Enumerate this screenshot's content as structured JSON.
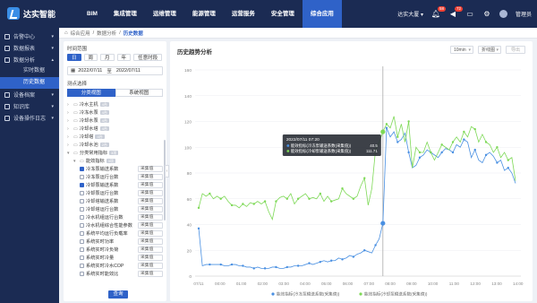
{
  "app": {
    "name": "达实智能"
  },
  "nav": [
    "BIM",
    "集成管理",
    "运维管理",
    "能源管理",
    "运营服务",
    "安全管理",
    "综合应用"
  ],
  "nav_active_index": 6,
  "top_right": {
    "building": "达实大厦",
    "bell_badge": "58",
    "alert_badge": "72",
    "user": "管理员"
  },
  "sidebar": {
    "items": [
      {
        "label": "告警中心",
        "expanded": false
      },
      {
        "label": "数据报表",
        "expanded": false
      },
      {
        "label": "数据分析",
        "expanded": true,
        "children": [
          {
            "label": "实时数据",
            "active": false
          },
          {
            "label": "历史数据",
            "active": true
          }
        ]
      },
      {
        "label": "设备档案",
        "expanded": false
      },
      {
        "label": "知识库",
        "expanded": false
      },
      {
        "label": "设备操作日志",
        "expanded": false
      }
    ]
  },
  "breadcrumb": [
    "综合应用",
    "数据分析",
    "历史数据"
  ],
  "filter": {
    "time_range_label": "时间范围",
    "time_tabs": [
      {
        "label": "日",
        "active": true
      },
      {
        "label": "周",
        "active": false
      },
      {
        "label": "月",
        "active": false
      },
      {
        "label": "年",
        "active": false
      },
      {
        "label": "任意时段",
        "active": false
      }
    ],
    "date_from": "2022/07/11",
    "date_to_sep": "至",
    "date_to": "2022/07/11",
    "point_label": "测点选择",
    "views": [
      {
        "label": "分类视图",
        "active": true
      },
      {
        "label": "系统视图",
        "active": false
      }
    ],
    "tree": [
      {
        "label": "冷水主机",
        "tag": "4台",
        "level": 0,
        "type": "folder"
      },
      {
        "label": "冷冻水泵",
        "tag": "4台",
        "level": 0,
        "type": "folder"
      },
      {
        "label": "冷却水泵",
        "tag": "4台",
        "level": 0,
        "type": "folder"
      },
      {
        "label": "冷却水塔",
        "tag": "4台",
        "level": 0,
        "type": "folder"
      },
      {
        "label": "冷却塔",
        "tag": "4台",
        "level": 0,
        "type": "folder"
      },
      {
        "label": "冷却水池",
        "tag": "2台",
        "level": 0,
        "type": "folder"
      },
      {
        "label": "分类常用指标",
        "tag": "3项",
        "level": 0,
        "type": "folder"
      },
      {
        "label": "能效指标",
        "tag": "3项",
        "level": 1,
        "type": "folder"
      },
      {
        "label": "冷冻泵输送系数",
        "level": 2,
        "checked": true,
        "select": "采集值"
      },
      {
        "label": "冷冻泵运行台数",
        "level": 2,
        "checked": false,
        "select": "采集值"
      },
      {
        "label": "冷却泵输送系数",
        "level": 2,
        "checked": true,
        "select": "采集值"
      },
      {
        "label": "冷却泵运行台数",
        "level": 2,
        "checked": false,
        "select": "采集值"
      },
      {
        "label": "冷却塔输送系数",
        "level": 2,
        "checked": false,
        "select": "采集值"
      },
      {
        "label": "冷却塔运行台数",
        "level": 2,
        "checked": false,
        "select": "采集值"
      },
      {
        "label": "冷水机组运行台数",
        "level": 2,
        "checked": false,
        "select": "采集值"
      },
      {
        "label": "冷水机组综合性能参数",
        "level": 2,
        "checked": false,
        "select": "采集值"
      },
      {
        "label": "系统平均运行负载率",
        "level": 2,
        "checked": false,
        "select": "采集值"
      },
      {
        "label": "系统实时功率",
        "level": 2,
        "checked": false,
        "select": "采集值"
      },
      {
        "label": "系统实时冷负荷",
        "level": 2,
        "checked": false,
        "select": "采集值"
      },
      {
        "label": "系统实时冷量",
        "level": 2,
        "checked": false,
        "select": "采集值"
      },
      {
        "label": "系统实时冷水COP",
        "level": 2,
        "checked": false,
        "select": "采集值"
      },
      {
        "label": "系统实时能效比",
        "level": 2,
        "checked": false,
        "select": "采集值"
      }
    ],
    "query_button": "查询"
  },
  "panel": {
    "title": "历史趋势分析",
    "interval": "10min",
    "chart_kind": "折线图",
    "export": "导出"
  },
  "colors": {
    "brand": "#2f62c8",
    "series_blue": "#4a90e2",
    "series_green": "#7ed957",
    "navy": "#1b2b53"
  },
  "chart_data": {
    "type": "line",
    "ylim": [
      0,
      160
    ],
    "yticks": [
      "0",
      "20",
      "40",
      "60",
      "80",
      "100",
      "120",
      "140",
      "160"
    ],
    "xticks": [
      "07/11",
      "00:00",
      "01:00",
      "02:00",
      "03:00",
      "04:00",
      "05:00",
      "06:00",
      "07:00",
      "08:00",
      "09:00",
      "10:00",
      "11:00",
      "12:00",
      "13:00",
      "14:00"
    ],
    "grid": true,
    "legend_position": "bottom",
    "series": [
      {
        "name": "能效指标(冷冻泵输送系数(采集值))",
        "color": "#4a90e2",
        "values": [
          37,
          8,
          9,
          9,
          9,
          9,
          9,
          8,
          8,
          9,
          9,
          8,
          8,
          7,
          7,
          6,
          7,
          6,
          6,
          6,
          7,
          7,
          6,
          6,
          7,
          7,
          8,
          8,
          8,
          9,
          10,
          9,
          10,
          11,
          12,
          11,
          12,
          12,
          14,
          13,
          14,
          16,
          15,
          17,
          18,
          20,
          19,
          18,
          24,
          29,
          41,
          115,
          108,
          112,
          104,
          106,
          111,
          96,
          84,
          86,
          92,
          94,
          98,
          96,
          94,
          92,
          96,
          99,
          98,
          96,
          102,
          100,
          106,
          104,
          92,
          98,
          90,
          88,
          94,
          96,
          93,
          88,
          90,
          82,
          84,
          80,
          72
        ]
      },
      {
        "name": "能效指标(冷却泵输送系数(采集值))",
        "color": "#7ed957",
        "values": [
          53,
          64,
          62,
          64,
          60,
          62,
          60,
          62,
          58,
          55,
          55,
          53,
          56,
          54,
          57,
          56,
          58,
          56,
          58,
          50,
          44,
          58,
          61,
          62,
          60,
          64,
          56,
          60,
          62,
          64,
          60,
          61,
          60,
          64,
          58,
          62,
          58,
          59,
          60,
          68,
          64,
          62,
          60,
          62,
          70,
          76,
          55,
          68,
          98,
          104,
          112,
          118,
          115,
          124,
          108,
          118,
          104,
          120,
          84,
          100,
          96,
          96,
          104,
          96,
          90,
          96,
          102,
          100,
          98,
          104,
          108,
          104,
          112,
          108,
          116,
          114,
          104,
          110,
          104,
          102,
          96,
          100,
          92,
          96,
          90,
          92,
          74
        ]
      }
    ],
    "tooltip": {
      "time": "2022/07/11 07:20",
      "rows": [
        {
          "label": "能效指标(冷冻泵输送系数(采集值))",
          "value": "40.5"
        },
        {
          "label": "能效指标(冷却泵输送系数(采集值))",
          "value": "111.71"
        }
      ]
    }
  }
}
